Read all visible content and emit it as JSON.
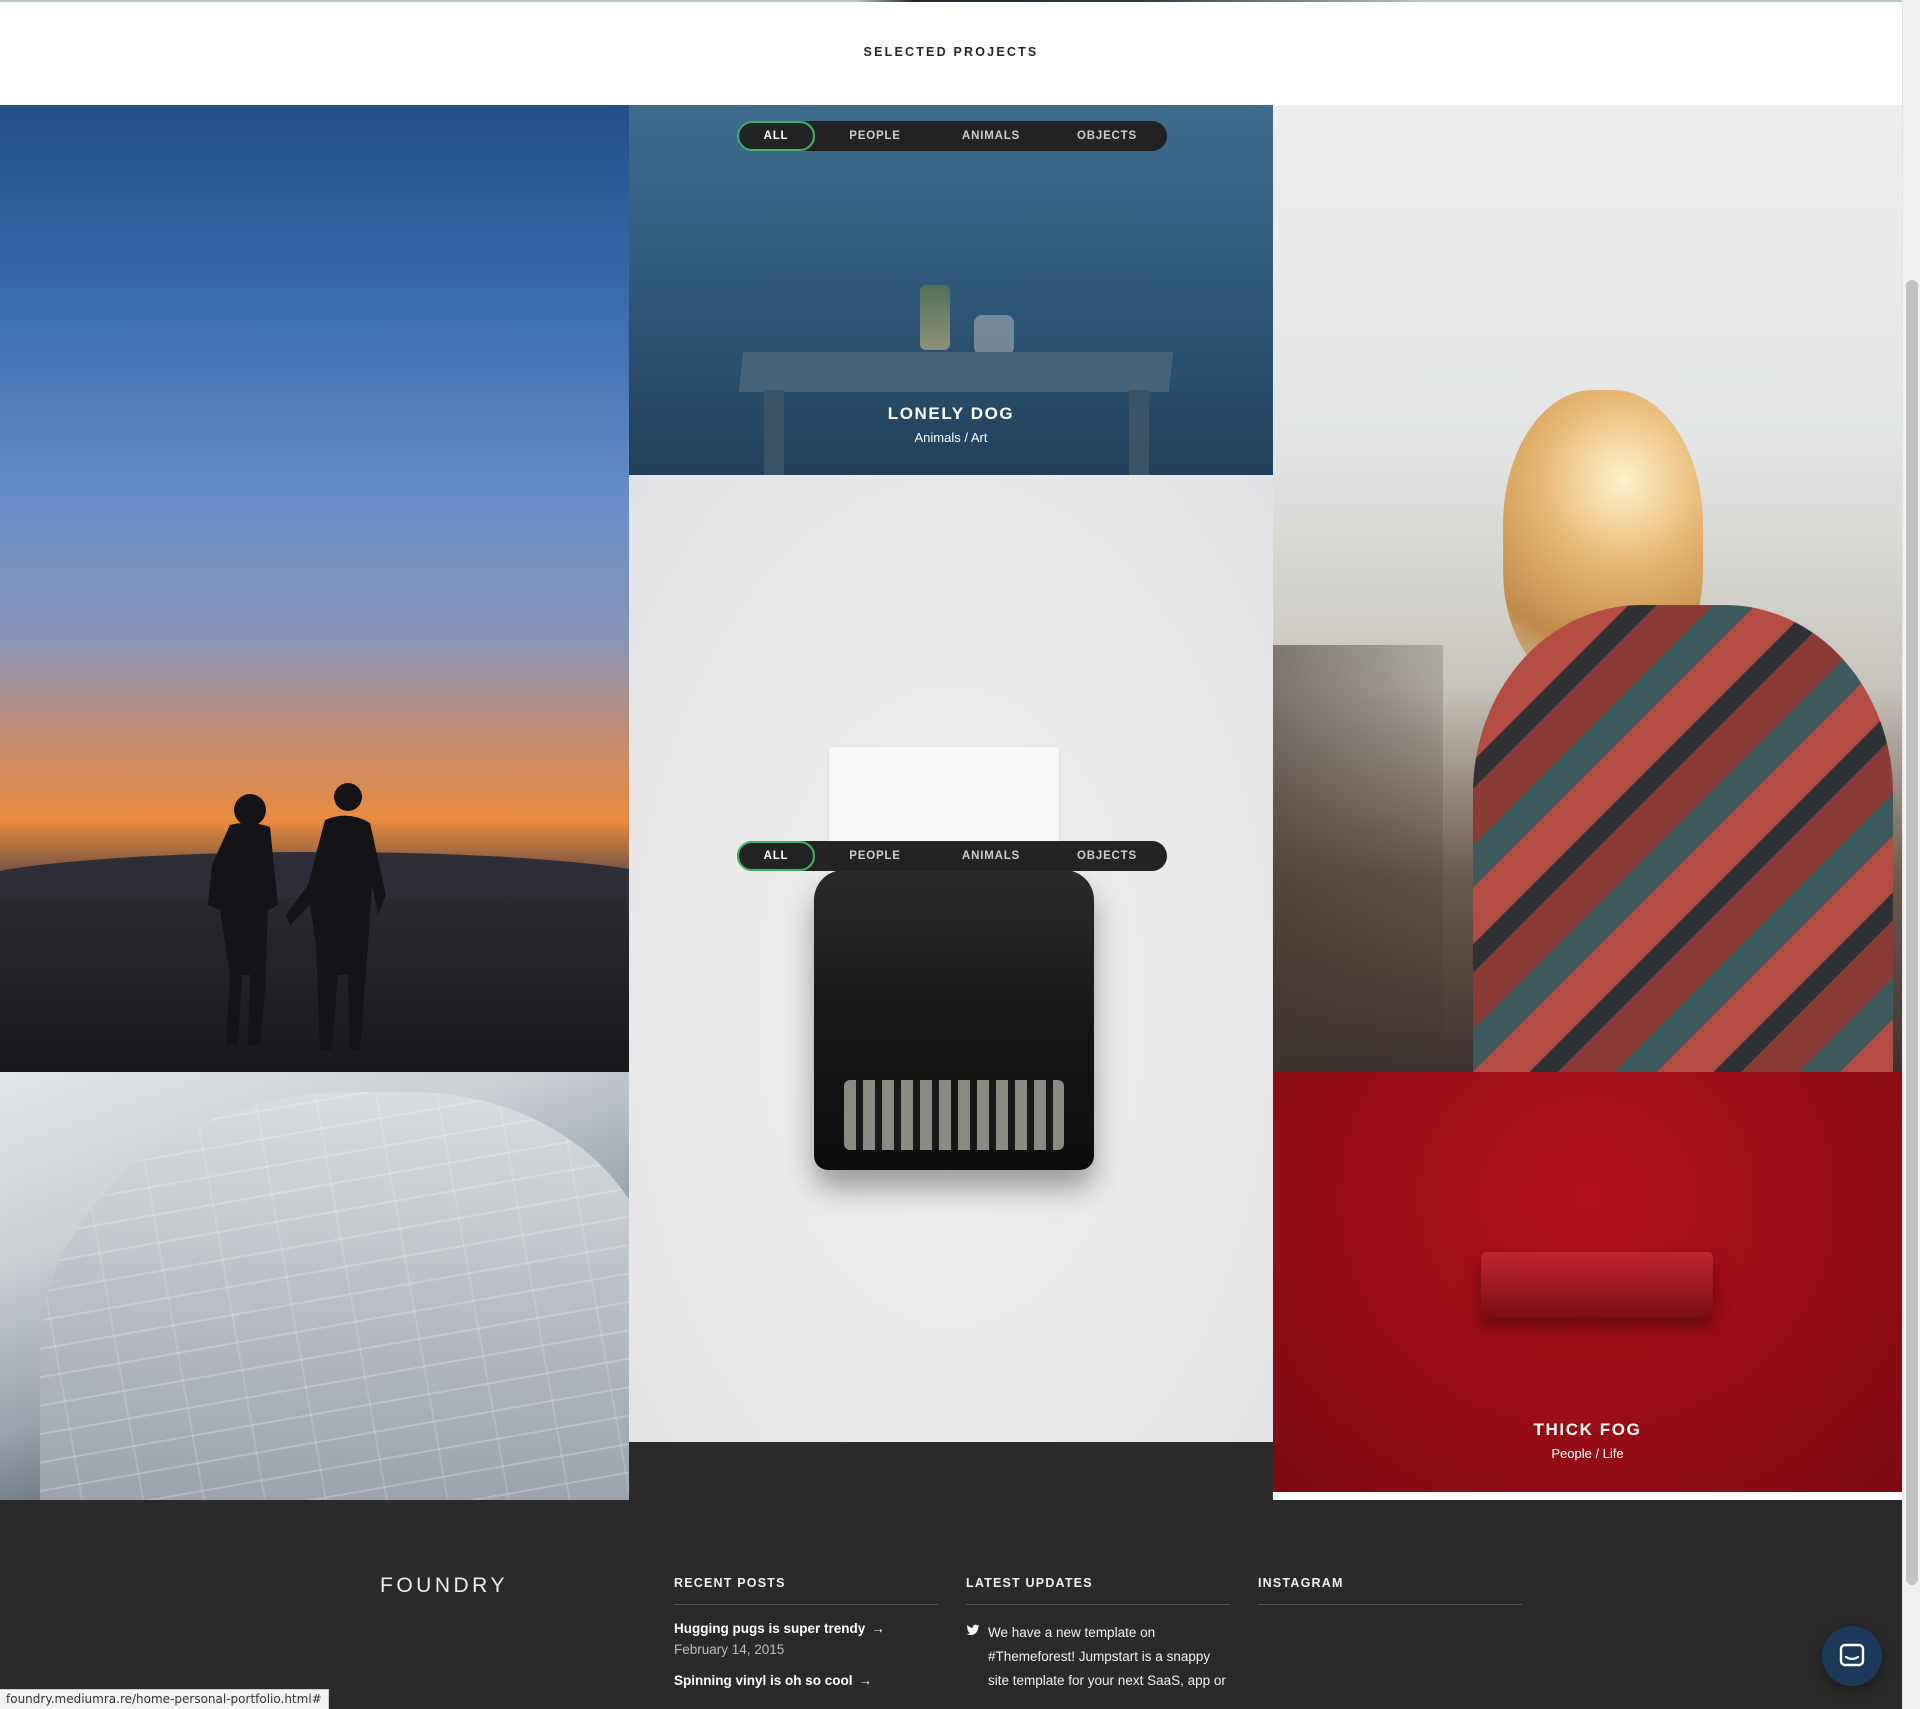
{
  "section": {
    "title": "SELECTED PROJECTS"
  },
  "filters": {
    "all": "ALL",
    "people": "PEOPLE",
    "animals": "ANIMALS",
    "objects": "OBJECTS",
    "active": "all"
  },
  "projects": [
    {
      "title": "LONELY DOG",
      "subtitle": "Animals / Art"
    },
    {
      "title": "THICK FOG",
      "subtitle": "People / Life"
    }
  ],
  "footer": {
    "brand": "FOUNDRY",
    "recent_posts": {
      "heading": "RECENT POSTS",
      "items": [
        {
          "title": "Hugging pugs is super trendy",
          "date": "February 14, 2015"
        },
        {
          "title": "Spinning vinyl is oh so cool",
          "date": ""
        }
      ]
    },
    "latest_updates": {
      "heading": "LATEST UPDATES",
      "tweet": "We have a new template on #Themeforest! Jumpstart is a snappy site template for your next SaaS, app or"
    },
    "instagram": {
      "heading": "INSTAGRAM"
    }
  },
  "icons": {
    "arrow": "arrow-right-icon",
    "twitter": "twitter-icon",
    "chat": "chat-icon"
  },
  "colors": {
    "accent": "#3fb36a",
    "footer_bg": "#2a2a2a",
    "filter_bg": "#232323"
  },
  "statusbar": {
    "url": "foundry.mediumra.re/home-personal-portfolio.html#"
  }
}
